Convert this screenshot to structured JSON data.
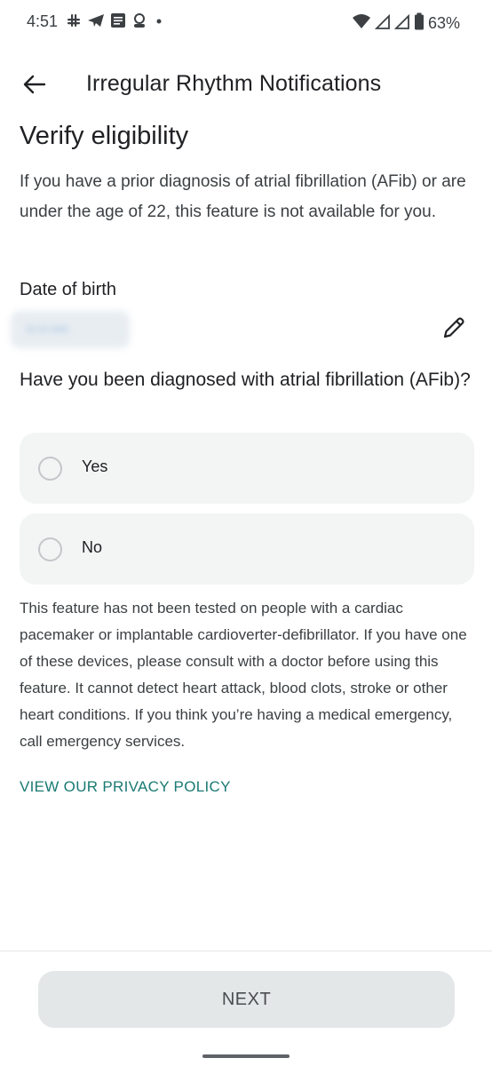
{
  "status_bar": {
    "time": "4:51",
    "battery": "63%",
    "icons": [
      "slack-icon",
      "telegram-icon",
      "message-icon",
      "incognito-icon",
      "dot-icon",
      "wifi-icon",
      "signal-icon",
      "signal-icon",
      "battery-icon"
    ]
  },
  "app_bar": {
    "title": "Irregular Rhythm Notifications",
    "back_icon": "arrow-left-icon"
  },
  "main": {
    "heading": "Verify eligibility",
    "intro": "If you have a prior diagnosis of atrial fibrillation (AFib) or are under the age of 22, this feature is not available for you.",
    "dob_label": "Date of birth",
    "dob_value": "•• •• ••••",
    "edit_icon": "pencil-icon",
    "question": "Have you been diagnosed with atrial fibrillation (AFib)?",
    "options": [
      {
        "label": "Yes",
        "selected": false
      },
      {
        "label": "No",
        "selected": false
      }
    ],
    "disclaimer": "This feature has not been tested on people with a cardiac pacemaker or implantable cardioverter-defibrillator. If you have one of these devices, please consult with a doctor before using this feature. It cannot detect heart attack, blood clots, stroke or other heart conditions. If you think you’re having a medical emergency, call emergency services.",
    "privacy_link": "VIEW OUR PRIVACY POLICY"
  },
  "footer": {
    "next_label": "NEXT"
  },
  "colors": {
    "accent_link": "#1a7a73",
    "option_bg": "#f3f4f4",
    "button_bg": "#e4e7e8"
  }
}
